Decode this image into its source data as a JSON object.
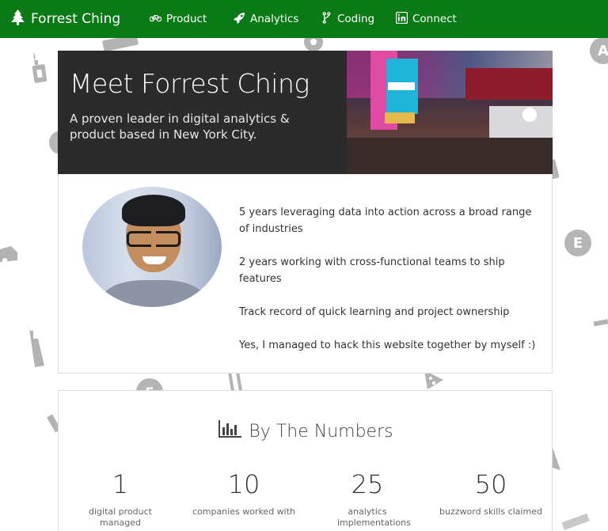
{
  "nav": {
    "brand": "Forrest Ching",
    "brand_icon": "tree-icon",
    "items": [
      {
        "label": "Product",
        "icon": "bicycle-icon"
      },
      {
        "label": "Analytics",
        "icon": "rocket-icon"
      },
      {
        "label": "Coding",
        "icon": "code-fork-icon"
      },
      {
        "label": "Connect",
        "icon": "linkedin-icon"
      }
    ]
  },
  "hero": {
    "title": "Meet Forrest Ching",
    "subtitle": "A proven leader in digital analytics & product based in New York City."
  },
  "about": {
    "bullets": [
      "5 years leveraging data into action across a broad range of industries",
      "2 years working with cross-functional teams to ship features",
      "Track record of quick learning and project ownership",
      "Yes, I managed to hack this website together by myself :)"
    ]
  },
  "numbers": {
    "heading": "By The Numbers",
    "heading_icon": "bar-chart-icon",
    "stats": [
      {
        "value": "1",
        "label": "digital product managed"
      },
      {
        "value": "10",
        "label": "companies worked with"
      },
      {
        "value": "25",
        "label": "analytics implementations"
      },
      {
        "value": "50",
        "label": "buzzword skills claimed"
      }
    ]
  },
  "colors": {
    "navbar": "#0a7a17",
    "hero_dark": "#2b2b2b",
    "decorative_gray": "#b5b5b5"
  }
}
